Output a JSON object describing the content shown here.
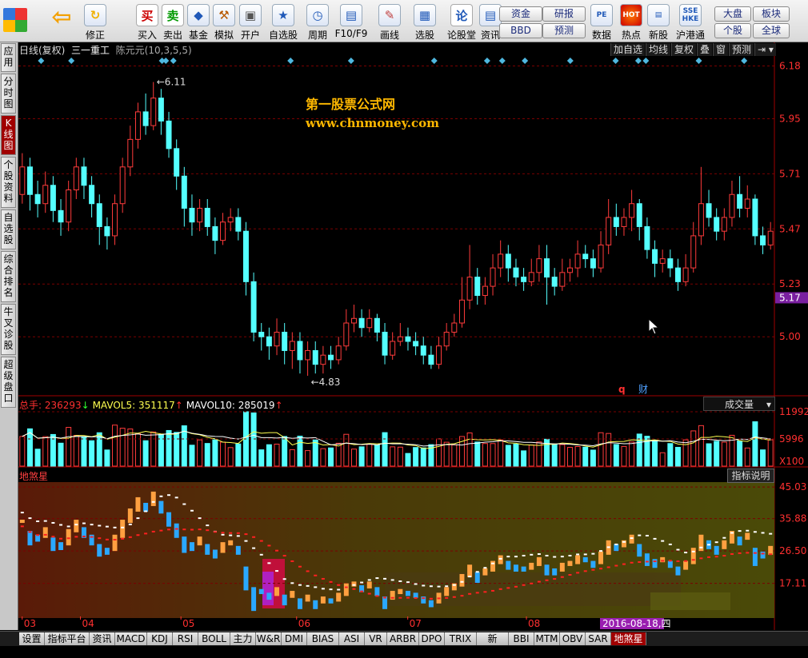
{
  "toolbar": {
    "left_tools": [
      {
        "label": "",
        "icon": "windows-grid-icon"
      },
      {
        "label": "",
        "icon": "back-arrow-icon"
      },
      {
        "label": "修正",
        "icon": "refresh-icon"
      },
      {
        "label": "买入",
        "icon": "buy-icon",
        "glyph": "买"
      },
      {
        "label": "卖出",
        "icon": "sell-icon",
        "glyph": "卖"
      },
      {
        "label": "基金",
        "icon": "fund-icon"
      },
      {
        "label": "模拟",
        "icon": "hammer-icon"
      },
      {
        "label": "开户",
        "icon": "lock-icon"
      },
      {
        "label": "自选股",
        "icon": "star-folder-icon"
      },
      {
        "label": "周期",
        "icon": "clock-icon"
      },
      {
        "label": "F10/F9",
        "icon": "f10-icon"
      },
      {
        "label": "画线",
        "icon": "pencil-icon"
      },
      {
        "label": "选股",
        "icon": "screen-icon"
      },
      {
        "label": "论股堂",
        "icon": "forum-icon",
        "glyph": "论"
      },
      {
        "label": "资讯",
        "icon": "news-icon"
      }
    ],
    "fund_pill": "资金",
    "bbd_pill": "BBD",
    "report_pill": "研报",
    "forecast_pill": "预测",
    "right_tools": [
      {
        "label": "数据",
        "icon": "pe-icon",
        "glyph": "PE"
      },
      {
        "label": "热点",
        "icon": "hot-icon",
        "glyph": "HOT"
      },
      {
        "label": "新股",
        "icon": "new-stock-icon"
      },
      {
        "label": "沪港通",
        "icon": "sse-hkex-icon",
        "glyph": "SSE HKE"
      }
    ],
    "market_pill": "大盘",
    "sector_pill": "板块",
    "stock_pill": "个股",
    "global_pill": "全球"
  },
  "left_tabs": [
    {
      "label": "应用",
      "active": false
    },
    {
      "label": "分时图",
      "active": false
    },
    {
      "label": "K线图",
      "active": true
    },
    {
      "label": "个股资料",
      "active": false
    },
    {
      "label": "自选股",
      "active": false
    },
    {
      "label": "综合排名",
      "active": false
    },
    {
      "label": "牛叉诊股",
      "active": false
    },
    {
      "label": "超级盘口",
      "active": false
    }
  ],
  "chart_header": {
    "period": "日线(复权)",
    "stock": "三一重工",
    "indicator": "陈元元(10,3,5,5)",
    "buttons": [
      "加自选",
      "均线",
      "复权",
      "叠",
      "窗",
      "预测"
    ]
  },
  "watermark": {
    "line1": "第一股票公式网",
    "line2": "www.chnmoney.com"
  },
  "price_axis": {
    "ticks": [
      "6.18",
      "5.95",
      "5.71",
      "5.47",
      "5.23",
      "5.00"
    ],
    "current": "5.17",
    "colors": {
      "current_bg": "#7a1fa0"
    }
  },
  "price_annotations": {
    "high": "6.11",
    "low": "4.83",
    "q_label": "q",
    "cai_label": "财"
  },
  "volume_panel": {
    "total_label": "总手: ",
    "total_value": "236293",
    "total_arrow": "↓",
    "ma5_label": "MAVOL5: ",
    "ma5_value": "351117",
    "ma5_arrow": "↑",
    "ma10_label": "MAVOL10: ",
    "ma10_value": "285019",
    "ma10_arrow": "↑",
    "selector": "成交量",
    "ticks": [
      "11992",
      "5996"
    ],
    "unit": "X100"
  },
  "indicator_panel": {
    "name": "地煞星",
    "help_button": "指标说明",
    "ticks": [
      "45.03",
      "35.88",
      "26.50",
      "17.11"
    ]
  },
  "x_axis": {
    "months": [
      "03",
      "04",
      "05",
      "06",
      "07",
      "08"
    ],
    "cursor_date": "2016-08-18,四"
  },
  "bottom_tabs": [
    "设置",
    "指标平台",
    "资讯",
    "MACD",
    "KDJ",
    "RSI",
    "BOLL",
    "主力",
    "W&R",
    "DMI",
    "BIAS",
    "ASI",
    "VR",
    "ARBR",
    "DPO",
    "TRIX",
    "新DMA",
    "BBI",
    "MTM",
    "OBV",
    "SAR",
    "地煞星"
  ],
  "active_bottom_tab": "地煞星",
  "chart_data": {
    "type": "candlestick",
    "title": "三一重工 日线(复权)",
    "ylim": [
      4.75,
      6.22
    ],
    "candles": [
      [
        5.62,
        5.74,
        5.8,
        5.58
      ],
      [
        5.74,
        5.62,
        5.78,
        5.55
      ],
      [
        5.62,
        5.58,
        5.68,
        5.52
      ],
      [
        5.58,
        5.66,
        5.72,
        5.54
      ],
      [
        5.66,
        5.55,
        5.7,
        5.5
      ],
      [
        5.55,
        5.5,
        5.6,
        5.44
      ],
      [
        5.5,
        5.64,
        5.68,
        5.46
      ],
      [
        5.64,
        5.74,
        5.78,
        5.6
      ],
      [
        5.74,
        5.66,
        5.78,
        5.6
      ],
      [
        5.66,
        5.58,
        5.7,
        5.52
      ],
      [
        5.58,
        5.48,
        5.62,
        5.4
      ],
      [
        5.48,
        5.44,
        5.52,
        5.38
      ],
      [
        5.44,
        5.58,
        5.62,
        5.4
      ],
      [
        5.58,
        5.74,
        5.78,
        5.54
      ],
      [
        5.74,
        5.86,
        5.92,
        5.7
      ],
      [
        5.86,
        5.98,
        6.02,
        5.82
      ],
      [
        5.98,
        5.92,
        6.06,
        5.88
      ],
      [
        5.92,
        6.04,
        6.11,
        5.9
      ],
      [
        6.04,
        5.94,
        6.08,
        5.88
      ],
      [
        5.94,
        5.82,
        5.98,
        5.78
      ],
      [
        5.82,
        5.7,
        5.86,
        5.64
      ],
      [
        5.7,
        5.56,
        5.74,
        5.48
      ],
      [
        5.56,
        5.5,
        5.62,
        5.44
      ],
      [
        5.5,
        5.56,
        5.6,
        5.46
      ],
      [
        5.56,
        5.48,
        5.6,
        5.44
      ],
      [
        5.48,
        5.42,
        5.52,
        5.36
      ],
      [
        5.42,
        5.5,
        5.54,
        5.4
      ],
      [
        5.5,
        5.52,
        5.56,
        5.46
      ],
      [
        5.52,
        5.46,
        5.56,
        5.42
      ],
      [
        5.46,
        5.24,
        5.5,
        5.18
      ],
      [
        5.24,
        5.02,
        5.28,
        4.98
      ],
      [
        5.02,
        5.0,
        5.06,
        4.94
      ],
      [
        5.0,
        4.96,
        5.04,
        4.9
      ],
      [
        4.96,
        5.02,
        5.08,
        4.92
      ],
      [
        5.02,
        4.94,
        5.06,
        4.88
      ],
      [
        4.94,
        4.98,
        5.02,
        4.86
      ],
      [
        4.98,
        4.9,
        5.02,
        4.84
      ],
      [
        4.9,
        4.94,
        4.98,
        4.83
      ],
      [
        4.94,
        4.88,
        4.98,
        4.84
      ],
      [
        4.88,
        4.92,
        4.96,
        4.84
      ],
      [
        4.92,
        4.9,
        4.96,
        4.86
      ],
      [
        4.9,
        4.96,
        5.0,
        4.88
      ],
      [
        4.96,
        5.06,
        5.12,
        4.94
      ],
      [
        5.06,
        5.08,
        5.14,
        5.02
      ],
      [
        5.08,
        5.04,
        5.12,
        5.0
      ],
      [
        5.04,
        5.08,
        5.12,
        5.02
      ],
      [
        5.08,
        5.02,
        5.1,
        4.98
      ],
      [
        5.02,
        4.92,
        5.06,
        4.88
      ],
      [
        4.92,
        4.98,
        5.02,
        4.9
      ],
      [
        4.98,
        5.0,
        5.06,
        4.96
      ],
      [
        5.0,
        4.98,
        5.04,
        4.94
      ],
      [
        4.98,
        4.96,
        5.02,
        4.92
      ],
      [
        4.96,
        4.92,
        5.0,
        4.88
      ],
      [
        4.92,
        4.88,
        4.96,
        4.86
      ],
      [
        4.88,
        4.96,
        5.0,
        4.86
      ],
      [
        4.96,
        5.02,
        5.06,
        4.94
      ],
      [
        5.02,
        5.06,
        5.1,
        5.0
      ],
      [
        5.06,
        5.16,
        5.26,
        5.04
      ],
      [
        5.16,
        5.26,
        5.4,
        5.12
      ],
      [
        5.26,
        5.18,
        5.3,
        5.14
      ],
      [
        5.18,
        5.22,
        5.26,
        5.14
      ],
      [
        5.22,
        5.3,
        5.36,
        5.18
      ],
      [
        5.3,
        5.36,
        5.42,
        5.26
      ],
      [
        5.36,
        5.3,
        5.4,
        5.24
      ],
      [
        5.3,
        5.26,
        5.34,
        5.22
      ],
      [
        5.26,
        5.24,
        5.3,
        5.2
      ],
      [
        5.24,
        5.28,
        5.34,
        5.22
      ],
      [
        5.28,
        5.34,
        5.4,
        5.24
      ],
      [
        5.34,
        5.26,
        5.4,
        5.14
      ],
      [
        5.26,
        5.22,
        5.3,
        5.18
      ],
      [
        5.22,
        5.28,
        5.34,
        5.2
      ],
      [
        5.28,
        5.3,
        5.34,
        5.24
      ],
      [
        5.3,
        5.36,
        5.42,
        5.26
      ],
      [
        5.36,
        5.34,
        5.4,
        5.3
      ],
      [
        5.34,
        5.3,
        5.38,
        5.26
      ],
      [
        5.3,
        5.4,
        5.46,
        5.28
      ],
      [
        5.4,
        5.52,
        5.6,
        5.36
      ],
      [
        5.52,
        5.48,
        5.58,
        5.44
      ],
      [
        5.48,
        5.52,
        5.56,
        5.44
      ],
      [
        5.52,
        5.58,
        5.64,
        5.46
      ],
      [
        5.58,
        5.48,
        5.6,
        5.42
      ],
      [
        5.48,
        5.38,
        5.52,
        5.34
      ],
      [
        5.38,
        5.32,
        5.42,
        5.26
      ],
      [
        5.32,
        5.34,
        5.38,
        5.28
      ],
      [
        5.34,
        5.3,
        5.38,
        5.26
      ],
      [
        5.3,
        5.24,
        5.34,
        5.2
      ],
      [
        5.24,
        5.3,
        5.36,
        5.22
      ],
      [
        5.3,
        5.44,
        5.5,
        5.28
      ],
      [
        5.44,
        5.58,
        5.74,
        5.4
      ],
      [
        5.58,
        5.52,
        5.64,
        5.48
      ],
      [
        5.52,
        5.46,
        5.56,
        5.42
      ],
      [
        5.46,
        5.52,
        5.56,
        5.42
      ],
      [
        5.52,
        5.62,
        5.68,
        5.48
      ],
      [
        5.62,
        5.56,
        5.7,
        5.52
      ],
      [
        5.56,
        5.6,
        5.66,
        5.52
      ],
      [
        5.6,
        5.44,
        5.62,
        5.4
      ],
      [
        5.44,
        5.4,
        5.48,
        5.36
      ],
      [
        5.4,
        5.46,
        5.5,
        5.38
      ]
    ],
    "volume_ticks": [
      "11992",
      "5996"
    ],
    "indicator_ylim": [
      8,
      46
    ]
  }
}
